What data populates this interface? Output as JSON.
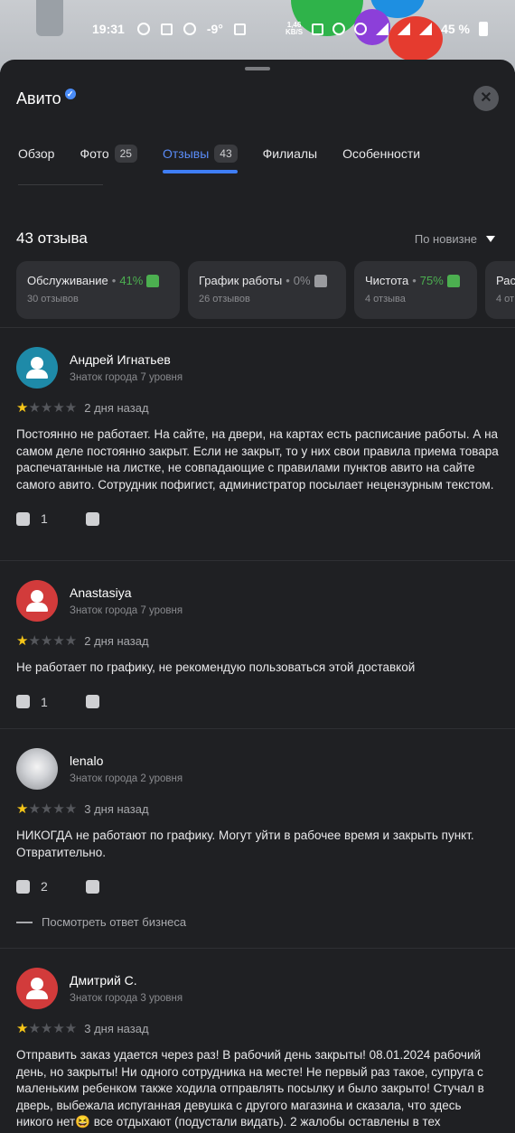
{
  "status_bar": {
    "time": "19:31",
    "temperature": "-9°",
    "speed_value": "1,46",
    "speed_unit": "KB/S",
    "battery": "45 %"
  },
  "header": {
    "title": "Авито"
  },
  "tabs": [
    {
      "label": "Обзор",
      "count": ""
    },
    {
      "label": "Фото",
      "count": "25"
    },
    {
      "label": "Отзывы",
      "count": "43"
    },
    {
      "label": "Филиалы",
      "count": ""
    },
    {
      "label": "Особенности",
      "count": ""
    }
  ],
  "reviews_summary": {
    "count_label": "43 отзыва",
    "sort_label": "По новизне"
  },
  "aspects": [
    {
      "name": "Обслуживание",
      "percent": "41%",
      "sub": "30 отзывов"
    },
    {
      "name": "График работы",
      "percent": "0%",
      "sub": "26 отзывов"
    },
    {
      "name": "Чистота",
      "percent": "75%",
      "sub": "4 отзыва"
    },
    {
      "name": "Рас",
      "percent": "",
      "sub": "4 от"
    }
  ],
  "reviews": [
    {
      "name": "Андрей Игнатьев",
      "level": "Знаток города 7 уровня",
      "rating": 1,
      "date": "2 дня назад",
      "text": "Постоянно не работает. На сайте, на двери, на картах есть расписание работы. А на самом деле постоянно закрыт. Если не закрыт, то у них свои правила приема товара распечатанные на листке, не совпадающие с правилами пунктов авито на сайте самого авито. Сотрудник пофигист, администратор посылает нецензурным текстом.",
      "likes": "1",
      "avatar_color": "#1e8aa8"
    },
    {
      "name": "Anastasiya",
      "level": "Знаток города 7 уровня",
      "rating": 1,
      "date": "2 дня назад",
      "text": "Не работает по графику, не рекомендую пользоваться этой доставкой",
      "likes": "1",
      "avatar_color": "#d23b3b"
    },
    {
      "name": "lenalo",
      "level": "Знаток города 2 уровня",
      "rating": 1,
      "date": "3 дня назад",
      "text": "НИКОГДА не работают по графику. Могут уйти в рабочее время и закрыть пункт. Отвратительно.",
      "likes": "2",
      "business_reply": "Посмотреть ответ бизнеса"
    },
    {
      "name": "Дмитрий С.",
      "level": "Знаток города 3 уровня",
      "rating": 1,
      "date": "3 дня назад",
      "text": "Отправить заказ удается через раз! В рабочий день закрыты! 08.01.2024 рабочий день, но закрыты! Ни одного сотрудника на месте! Не первый раз такое, супруга с маленьким ребенком также ходила отправлять посылку и было закрыто! Стучал в дверь, выбежала испуганная девушка с другого магазина и сказала, что здесь никого нет😆 все отдыхают (подустали видать). 2 жалобы оставлены в тех",
      "avatar_color": "#d23b3b"
    }
  ],
  "colors": {
    "background": "#1f2023",
    "card": "#2f3034",
    "accent": "#3f7ef6",
    "positive": "#4caf50",
    "star": "#f5c518"
  }
}
